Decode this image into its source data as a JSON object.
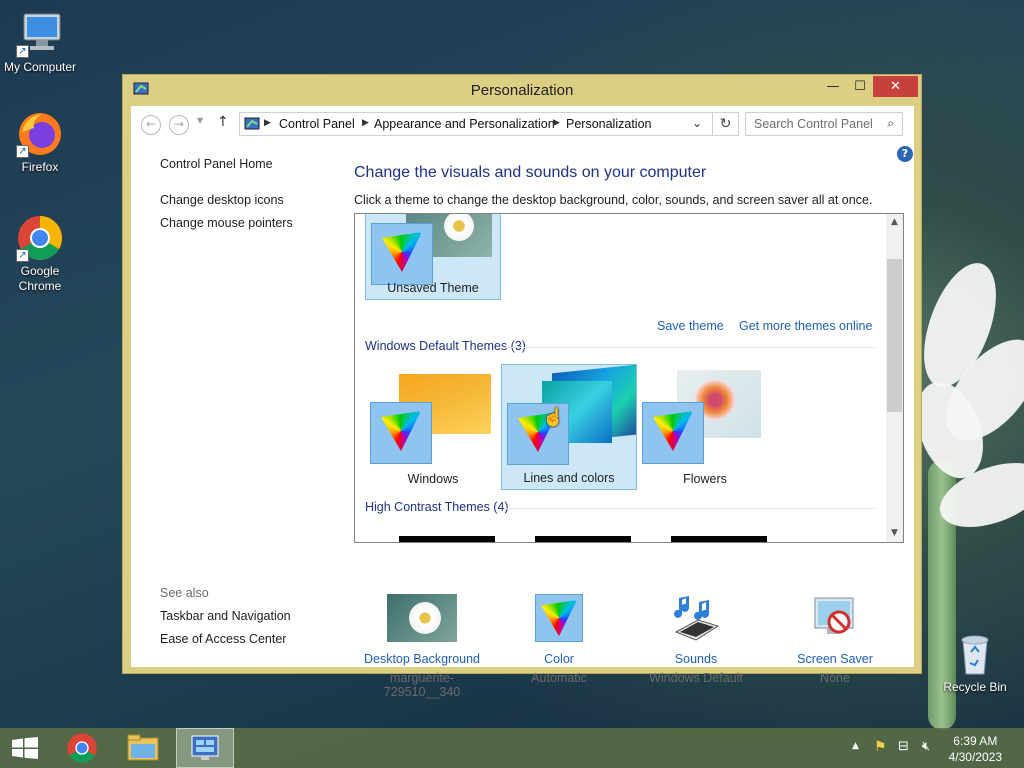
{
  "desktop": {
    "icons": [
      {
        "label": "My Computer"
      },
      {
        "label": "Firefox"
      },
      {
        "label": "Google Chrome"
      },
      {
        "label": "Recycle Bin"
      }
    ]
  },
  "window": {
    "title": "Personalization",
    "controls": {
      "minimize": "—",
      "maximize": "☐",
      "close": "✕"
    }
  },
  "address": {
    "crumbs": [
      "Control Panel",
      "Appearance and Personalization",
      "Personalization"
    ],
    "search_placeholder": "Search Control Panel"
  },
  "sidebar": {
    "home": "Control Panel Home",
    "links": [
      "Change desktop icons",
      "Change mouse pointers"
    ],
    "see_also_label": "See also",
    "see_also": [
      "Taskbar and Navigation",
      "Ease of Access Center"
    ]
  },
  "main": {
    "heading": "Change the visuals and sounds on your computer",
    "description": "Click a theme to change the desktop background, color, sounds, and screen saver all at once.",
    "save_theme": "Save theme",
    "get_more": "Get more themes online",
    "unsaved_theme": "Unsaved Theme",
    "default_section": "Windows Default Themes (3)",
    "default_themes": [
      "Windows",
      "Lines and colors",
      "Flowers"
    ],
    "high_contrast_section": "High Contrast Themes (4)"
  },
  "bottom": [
    {
      "label": "Desktop Background",
      "value": "marguerite-729510__340"
    },
    {
      "label": "Color",
      "value": "Automatic"
    },
    {
      "label": "Sounds",
      "value": "Windows Default"
    },
    {
      "label": "Screen Saver",
      "value": "None"
    }
  ],
  "taskbar": {
    "time": "6:39 AM",
    "date": "4/30/2023"
  },
  "colors": {
    "window_frame": "#dccf84",
    "link": "#1f5fb8",
    "heading": "#1e3287",
    "close": "#c7413c"
  }
}
